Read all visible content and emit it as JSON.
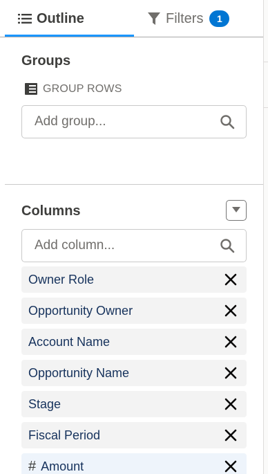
{
  "tabs": {
    "outline_label": "Outline",
    "filters_label": "Filters",
    "filters_badge": "1"
  },
  "groups": {
    "title": "Groups",
    "group_rows_label": "GROUP ROWS",
    "search_placeholder": "Add group..."
  },
  "columns": {
    "title": "Columns",
    "search_placeholder": "Add column...",
    "items": [
      {
        "label": "Owner Role",
        "type": "text"
      },
      {
        "label": "Opportunity Owner",
        "type": "text"
      },
      {
        "label": "Account Name",
        "type": "text"
      },
      {
        "label": "Opportunity Name",
        "type": "text"
      },
      {
        "label": "Stage",
        "type": "text"
      },
      {
        "label": "Fiscal Period",
        "type": "text"
      },
      {
        "label": "Amount",
        "type": "numeric",
        "type_symbol": "#"
      }
    ]
  },
  "icons": {
    "outline": "list-icon",
    "filters": "funnel-icon",
    "group_rows": "table-rows-icon",
    "search": "search-icon",
    "dropdown": "chevron-down-icon",
    "remove": "close-icon"
  },
  "colors": {
    "accent": "#1b96ff",
    "badge": "#0176d3",
    "item_text": "#16325c",
    "item_bg": "#f3f3f3",
    "numeric_item_bg": "#eef4fb"
  }
}
